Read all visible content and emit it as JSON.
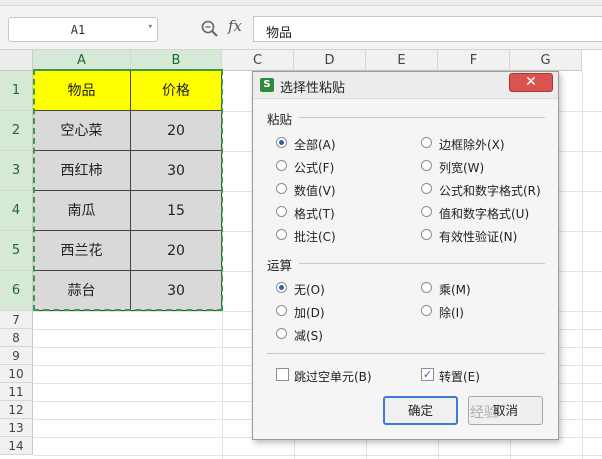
{
  "formula_bar": {
    "name_box": "A1",
    "name_box_arrow": "▾",
    "zoom_icon": "zoom-icon",
    "fx_label": "fx",
    "formula_value": "物品"
  },
  "columns": [
    "A",
    "B",
    "C",
    "D",
    "E",
    "F",
    "G"
  ],
  "rows": [
    "1",
    "2",
    "3",
    "4",
    "5",
    "6",
    "7",
    "8",
    "9",
    "10",
    "11",
    "12",
    "13",
    "14"
  ],
  "table": [
    [
      "物品",
      "价格"
    ],
    [
      "空心菜",
      "20"
    ],
    [
      "西红柿",
      "30"
    ],
    [
      "南瓜",
      "15"
    ],
    [
      "西兰花",
      "20"
    ],
    [
      "蒜台",
      "30"
    ]
  ],
  "dialog": {
    "title": "选择性粘贴",
    "logo": "S",
    "close": "✕",
    "paste_label": "粘贴",
    "paste_options": [
      {
        "label": "全部(A)",
        "checked": true
      },
      {
        "label": "边框除外(X)",
        "checked": false
      },
      {
        "label": "公式(F)",
        "checked": false
      },
      {
        "label": "列宽(W)",
        "checked": false
      },
      {
        "label": "数值(V)",
        "checked": false
      },
      {
        "label": "公式和数字格式(R)",
        "checked": false
      },
      {
        "label": "格式(T)",
        "checked": false
      },
      {
        "label": "值和数字格式(U)",
        "checked": false
      },
      {
        "label": "批注(C)",
        "checked": false
      },
      {
        "label": "有效性验证(N)",
        "checked": false
      }
    ],
    "operation_label": "运算",
    "operation_options": [
      {
        "label": "无(O)",
        "checked": true
      },
      {
        "label": "乘(M)",
        "checked": false
      },
      {
        "label": "加(D)",
        "checked": false
      },
      {
        "label": "除(I)",
        "checked": false
      },
      {
        "label": "减(S)",
        "checked": false
      }
    ],
    "skip_blanks": {
      "label": "跳过空单元(B)",
      "checked": false
    },
    "transpose": {
      "label": "转置(E)",
      "checked": true
    },
    "ok": "确定",
    "cancel": "取消"
  },
  "watermark": "经验",
  "colors": {
    "header_fill": "#ffff00",
    "body_fill": "#d9d9d9",
    "marquee": "#3b9a45",
    "accent": "#3d7bd6"
  }
}
